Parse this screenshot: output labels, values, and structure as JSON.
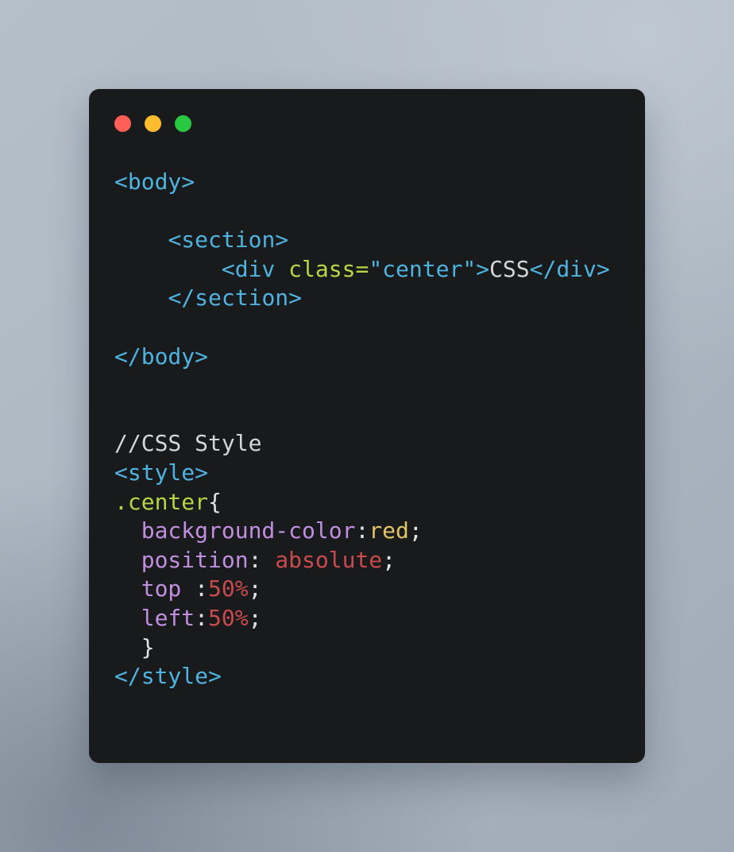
{
  "window": {
    "titlebar_buttons": [
      {
        "name": "close-button",
        "icon": "close-traffic-light",
        "color": "#ff5f56"
      },
      {
        "name": "minimize-button",
        "icon": "minimize-traffic-light",
        "color": "#febc2e"
      },
      {
        "name": "maximize-button",
        "icon": "maximize-traffic-light",
        "color": "#28c840"
      }
    ],
    "background_color": "#191a1c",
    "page_background_color": "#b0bac4"
  },
  "editor": {
    "language": "html",
    "theme_colors": {
      "tag": "#4fb3e0",
      "attribute": "#bcd444",
      "string": "#4fb3e0",
      "text": "#d6d6d6",
      "punctuation": "#e3e3e3",
      "comment": "#d6d6d6",
      "selector": "#bcd444",
      "property": "#c08fe0",
      "value_gold": "#e0c368",
      "value_red": "#cb4a4d"
    },
    "plain_text": "<body>\n\n    <section>\n        <div class=\"center\">CSS</div>\n    </section>\n\n</body>\n\n\n//CSS Style\n<style>\n.center{\n  background-color:red;\n  position: absolute;\n  top :50%;\n  left:50%;\n  }\n</style>",
    "lines": [
      {
        "n": 1,
        "tokens": [
          {
            "t": "<body>",
            "c": "tag"
          }
        ]
      },
      {
        "n": 2,
        "tokens": []
      },
      {
        "n": 3,
        "tokens": [
          {
            "t": "    ",
            "c": "plain"
          },
          {
            "t": "<section>",
            "c": "tag"
          }
        ]
      },
      {
        "n": 4,
        "tokens": [
          {
            "t": "        ",
            "c": "plain"
          },
          {
            "t": "<div ",
            "c": "tag"
          },
          {
            "t": "class",
            "c": "attr"
          },
          {
            "t": "=",
            "c": "attr"
          },
          {
            "t": "\"center\"",
            "c": "string"
          },
          {
            "t": ">",
            "c": "tag"
          },
          {
            "t": "CSS",
            "c": "text"
          },
          {
            "t": "</div>",
            "c": "tag"
          }
        ]
      },
      {
        "n": 5,
        "tokens": [
          {
            "t": "    ",
            "c": "plain"
          },
          {
            "t": "</section>",
            "c": "tag"
          }
        ]
      },
      {
        "n": 6,
        "tokens": []
      },
      {
        "n": 7,
        "tokens": [
          {
            "t": "</body>",
            "c": "tag"
          }
        ]
      },
      {
        "n": 8,
        "tokens": []
      },
      {
        "n": 9,
        "tokens": []
      },
      {
        "n": 10,
        "tokens": [
          {
            "t": "//CSS Style",
            "c": "comment"
          }
        ]
      },
      {
        "n": 11,
        "tokens": [
          {
            "t": "<style>",
            "c": "tag"
          }
        ]
      },
      {
        "n": 12,
        "tokens": [
          {
            "t": ".center",
            "c": "selector"
          },
          {
            "t": "{",
            "c": "punct"
          }
        ]
      },
      {
        "n": 13,
        "tokens": [
          {
            "t": "  ",
            "c": "plain"
          },
          {
            "t": "background-color",
            "c": "prop"
          },
          {
            "t": ":",
            "c": "punct"
          },
          {
            "t": "red",
            "c": "valgold"
          },
          {
            "t": ";",
            "c": "punct"
          }
        ]
      },
      {
        "n": 14,
        "tokens": [
          {
            "t": "  ",
            "c": "plain"
          },
          {
            "t": "position",
            "c": "prop"
          },
          {
            "t": ": ",
            "c": "punct"
          },
          {
            "t": "absolute",
            "c": "valred"
          },
          {
            "t": ";",
            "c": "punct"
          }
        ]
      },
      {
        "n": 15,
        "tokens": [
          {
            "t": "  ",
            "c": "plain"
          },
          {
            "t": "top ",
            "c": "prop"
          },
          {
            "t": ":",
            "c": "punct"
          },
          {
            "t": "50%",
            "c": "valred"
          },
          {
            "t": ";",
            "c": "punct"
          }
        ]
      },
      {
        "n": 16,
        "tokens": [
          {
            "t": "  ",
            "c": "plain"
          },
          {
            "t": "left",
            "c": "prop"
          },
          {
            "t": ":",
            "c": "punct"
          },
          {
            "t": "50%",
            "c": "valred"
          },
          {
            "t": ";",
            "c": "punct"
          }
        ]
      },
      {
        "n": 17,
        "tokens": [
          {
            "t": "  ",
            "c": "plain"
          },
          {
            "t": "}",
            "c": "punct"
          }
        ]
      },
      {
        "n": 18,
        "tokens": [
          {
            "t": "</style>",
            "c": "tag"
          }
        ]
      }
    ]
  }
}
